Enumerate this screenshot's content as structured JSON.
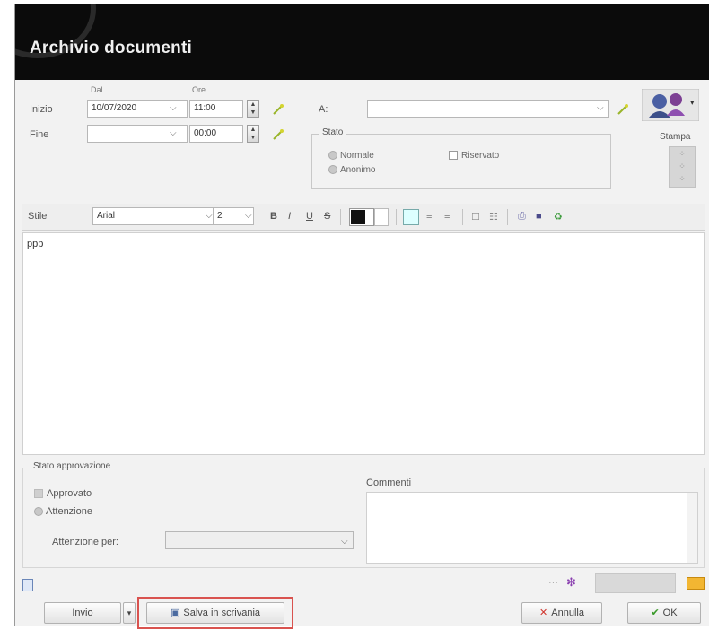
{
  "window": {
    "title": "Archivio documenti"
  },
  "header": {
    "dal_label": "Dal",
    "ore1_label": "Ore",
    "inizio_label": "Inizio",
    "fine_label": "Fine",
    "inizio_date": "10/07/2020",
    "inizio_time": "11:00",
    "fine_date": "",
    "fine_time": "00:00",
    "a_label": "A:",
    "a_value": "",
    "stato_label": "Stato",
    "stato_options": [
      "Normale",
      "Anonimo"
    ],
    "privato_label": "Riservato",
    "stampa_label": "Stampa"
  },
  "toolbar": {
    "stile_label": "Stile",
    "font_value": "Arial",
    "size_value": "2",
    "bold": "B",
    "italic": "I",
    "underline": "U",
    "strike": "S"
  },
  "editor": {
    "content": "ppp"
  },
  "approval": {
    "section_label": "Stato approvazione",
    "approvato_label": "Approvato",
    "attenzione_label": "Attenzione",
    "attenzione_per_label": "Attenzione per:",
    "commenti_label": "Commenti"
  },
  "footer": {
    "invio_label": "Invio",
    "scrivania_label": "Salva in scrivania",
    "annulla_label": "Annulla",
    "ok_label": "OK",
    "highlight_color": "#d9534f"
  }
}
